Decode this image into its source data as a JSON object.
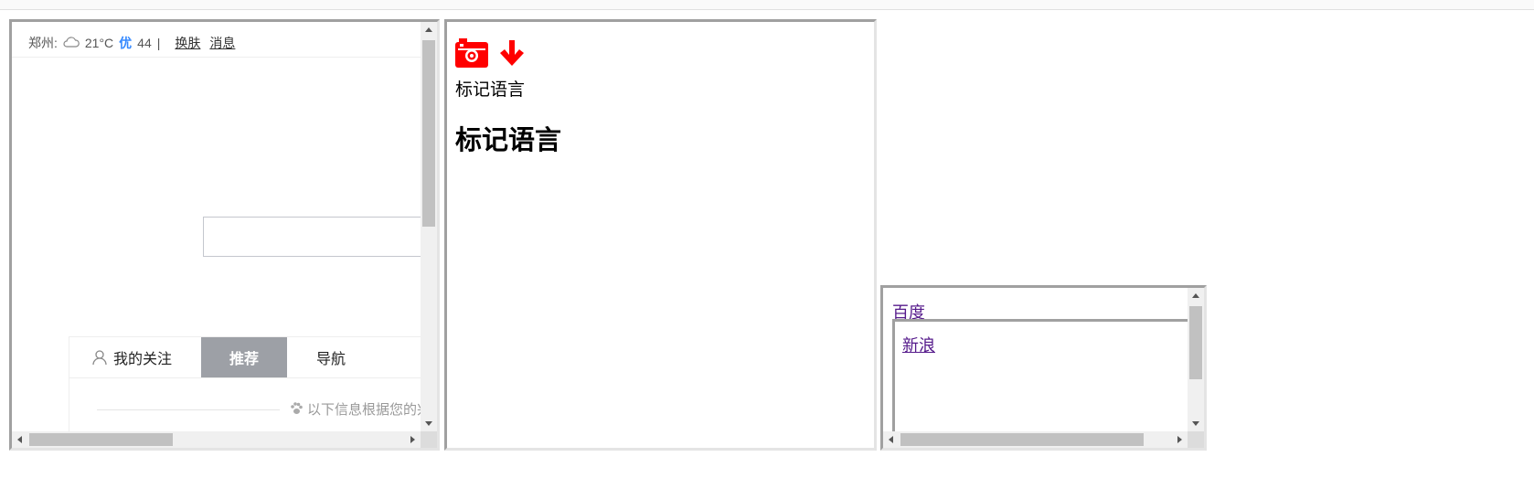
{
  "frame1": {
    "weather": {
      "city": "郑州:",
      "icon": "cloud-icon",
      "temperature": "21°C",
      "air_quality_label": "优",
      "air_quality_value": "44",
      "separator": "|",
      "skin_link": "换肤",
      "message_link": "消息"
    },
    "tabs": {
      "follow": "我的关注",
      "recommend": "推荐",
      "nav": "导航"
    },
    "feed_notice": "以下信息根据您的兴"
  },
  "frame2": {
    "icons": [
      "camera-icon",
      "arrow-down-icon"
    ],
    "text": "标记语言",
    "heading": "标记语言"
  },
  "frame3": {
    "link_baidu": "百度",
    "link_sina": "新浪"
  },
  "colors": {
    "accent_blue": "#3388ff",
    "tab_active_bg": "#9da0a6",
    "icon_red": "#ff0000",
    "visited_link": "#551a8b"
  }
}
